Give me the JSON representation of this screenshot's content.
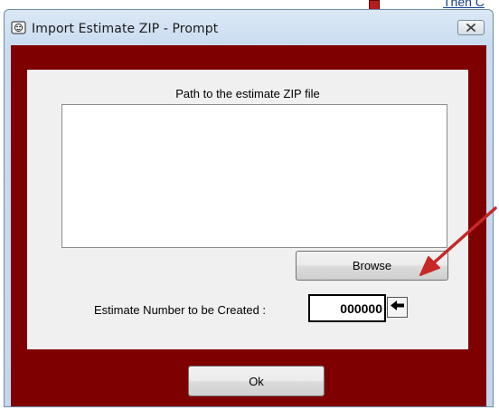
{
  "background": {
    "fragment_text": "Then C"
  },
  "window": {
    "title": "Import Estimate ZIP - Prompt",
    "icon": "app-icon",
    "close_icon": "close-icon"
  },
  "form": {
    "path_label": "Path to the estimate ZIP file",
    "path_value": "",
    "browse_label": "Browse",
    "estimate_label": "Estimate Number to be Created :",
    "estimate_value": "000000",
    "arrow_icon": "left-arrow-icon",
    "ok_label": "Ok"
  },
  "colors": {
    "frame_red": "#7f0000",
    "annotation_arrow": "#c62828"
  }
}
